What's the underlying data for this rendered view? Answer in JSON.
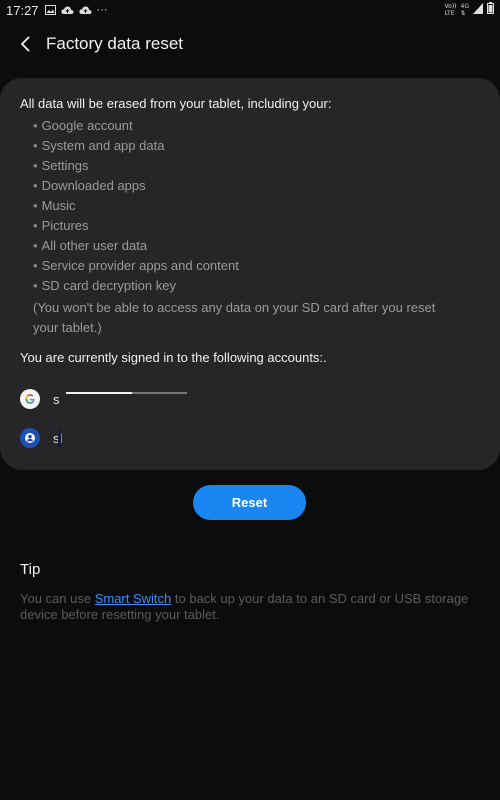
{
  "status_bar": {
    "time": "17:27",
    "more": "···",
    "volte_top": "Vo))",
    "volte_bottom": "LTE",
    "net_top": "4G",
    "net_bottom": "⇅"
  },
  "header": {
    "title": "Factory data reset"
  },
  "card": {
    "intro": "All data will be erased from your tablet, including your:",
    "items": [
      "Google account",
      "System and app data",
      "Settings",
      "Downloaded apps",
      "Music",
      "Pictures",
      "All other user data",
      "Service provider apps and content",
      "SD card decryption key"
    ],
    "sd_note": "(You won't be able to access any data on your SD card after you reset your tablet.)",
    "signed_in": "You are currently signed in to the following accounts:.",
    "accounts": [
      {
        "icon": "google-icon",
        "text": "s"
      },
      {
        "icon": "samsung-account-icon",
        "text": "sl"
      }
    ]
  },
  "reset_label": "Reset",
  "tip": {
    "title": "Tip",
    "body_prefix": "You can use ",
    "link_text": "Smart Switch",
    "body_suffix": " to back up your data to an SD card or USB storage device before resetting your tablet."
  },
  "colors": {
    "background": "#0c0c0d",
    "card": "#262628",
    "accent": "#1a86f2",
    "link": "#3d8ff5"
  }
}
